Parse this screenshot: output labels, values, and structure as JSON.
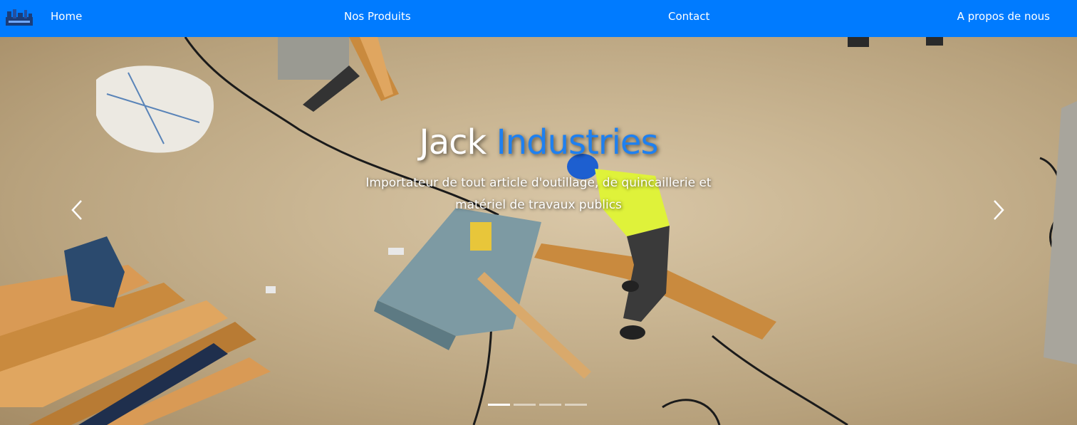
{
  "navbar": {
    "logo_icon": "jack-industries-logo",
    "links": [
      {
        "label": "Home"
      },
      {
        "label": "Nos Produits"
      },
      {
        "label": "Contact"
      },
      {
        "label": "A propos de nous"
      }
    ],
    "background_color": "#007bff"
  },
  "hero": {
    "title_word_1": "Jack",
    "title_word_2": "Industries",
    "title_accent_color": "#1e80f0",
    "subtitle": "Importateur de tout article d'outillage, de quincaillerie et matériel de travaux publics",
    "prev_icon": "chevron-left-icon",
    "next_icon": "chevron-right-icon",
    "indicators": [
      {
        "active": true
      },
      {
        "active": false
      },
      {
        "active": false
      },
      {
        "active": false
      }
    ]
  }
}
